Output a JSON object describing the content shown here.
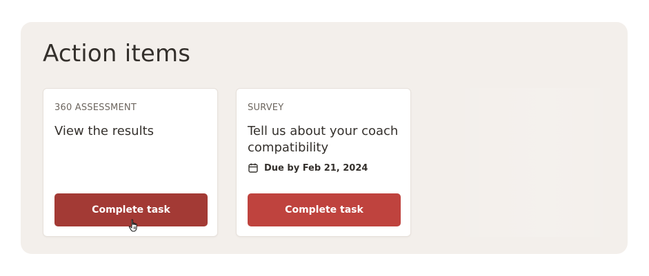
{
  "panel": {
    "title": "Action items"
  },
  "cards": [
    {
      "type": "360 ASSESSMENT",
      "title": "View the results",
      "button_label": "Complete task",
      "state": "hover"
    },
    {
      "type": "SURVEY",
      "title": "Tell us about your coach compatibility",
      "due_label": "Due by Feb 21, 2024",
      "due_icon": "calendar-icon",
      "button_label": "Complete task",
      "state": "normal"
    }
  ],
  "colors": {
    "panel_bg": "#f3efeb",
    "button_normal": "#bf433e",
    "button_hover": "#a33a35",
    "text_primary": "#34302c",
    "text_secondary": "#6d665f"
  },
  "cursor": "pointer-hand-cursor"
}
